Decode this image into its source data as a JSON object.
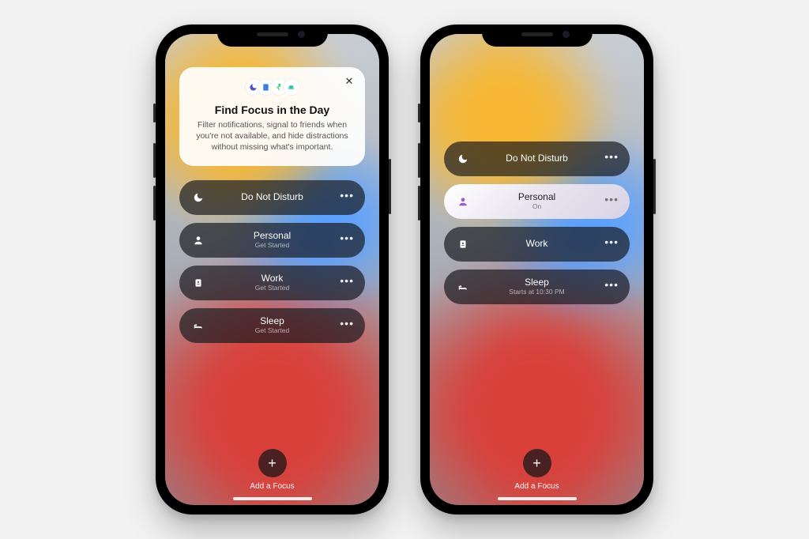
{
  "left": {
    "card": {
      "title": "Find Focus in the Day",
      "body": "Filter notifications, signal to friends when you're not available, and hide distractions without missing what's important.",
      "close": "✕",
      "icons": [
        "moon-icon",
        "book-icon",
        "running-icon",
        "car-icon"
      ]
    },
    "focus": [
      {
        "icon": "moon-icon",
        "name": "Do Not Disturb",
        "sub": ""
      },
      {
        "icon": "person-icon",
        "name": "Personal",
        "sub": "Get Started"
      },
      {
        "icon": "badge-icon",
        "name": "Work",
        "sub": "Get Started"
      },
      {
        "icon": "bed-icon",
        "name": "Sleep",
        "sub": "Get Started"
      }
    ],
    "add_label": "Add a Focus",
    "add_glyph": "+"
  },
  "right": {
    "focus": [
      {
        "icon": "moon-icon",
        "name": "Do Not Disturb",
        "sub": "",
        "active": false
      },
      {
        "icon": "person-icon",
        "name": "Personal",
        "sub": "On",
        "active": true
      },
      {
        "icon": "badge-icon",
        "name": "Work",
        "sub": "",
        "active": false
      },
      {
        "icon": "bed-icon",
        "name": "Sleep",
        "sub": "Starts at 10:30 PM",
        "active": false
      }
    ],
    "add_label": "Add a Focus",
    "add_glyph": "+"
  },
  "more_glyph": "•••",
  "colors": {
    "moon": "#4a55c9",
    "book": "#3b7de0",
    "run": "#3fcf6e",
    "car": "#2fc4b0",
    "personal_active": "#9b59d0"
  }
}
